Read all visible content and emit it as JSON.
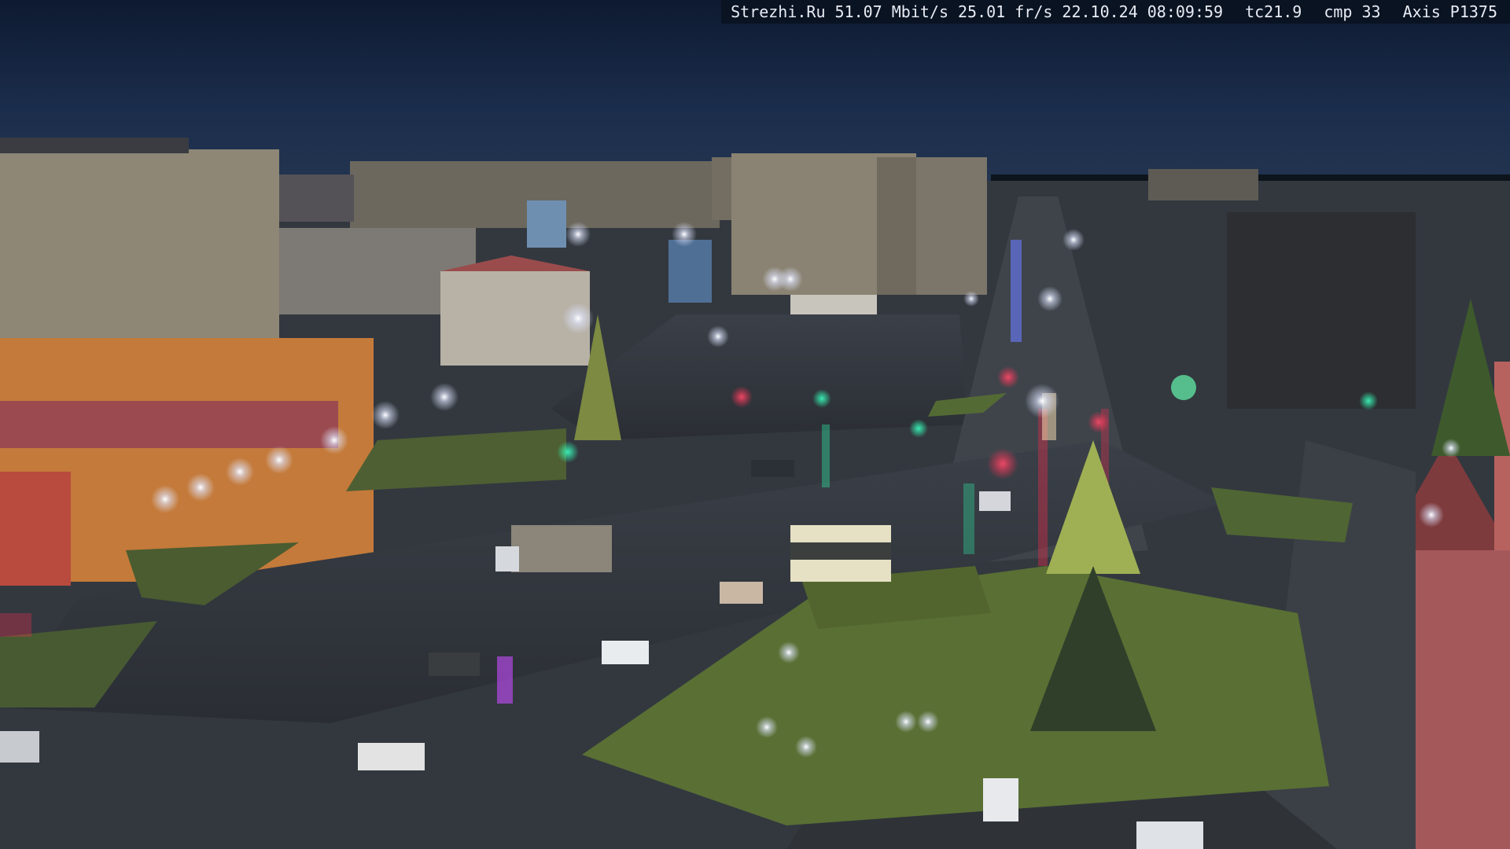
{
  "overlay": {
    "site": "Strezhi.Ru",
    "bitrate": "51.07 Mbit/s",
    "framerate": "25.01 fr/s",
    "date": "22.10.24",
    "time": "08:09:59",
    "tc": "tc21.9",
    "cmp": "cmp 33",
    "camera": "Axis P1375"
  },
  "scene": {
    "sky_color": "#15233d",
    "ground_color": "#3a3f45",
    "grass_color": "#566c33",
    "building_color": "#8d8676",
    "lamp_color": "#f4f6ff",
    "red_light": "#ff2a4e",
    "green_light": "#2dffb0"
  }
}
